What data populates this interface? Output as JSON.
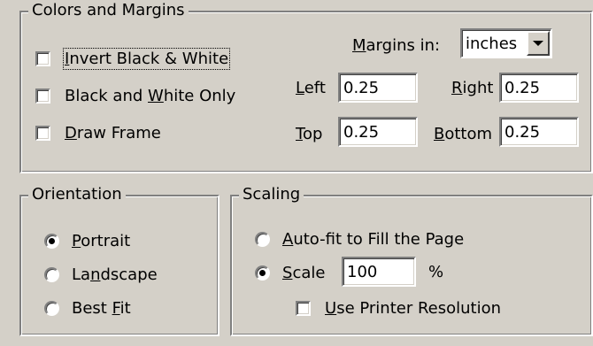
{
  "colors_margins": {
    "legend": "Colors and Margins",
    "invert_prefix": "",
    "invert_key": "I",
    "invert_rest": "nvert Black & White",
    "bw_prefix": "Black and ",
    "bw_key": "W",
    "bw_rest": "hite Only",
    "frame_prefix": "",
    "frame_key": "D",
    "frame_rest": "raw Frame",
    "invert_checked": false,
    "bw_checked": false,
    "frame_checked": false,
    "margins_in_key": "M",
    "margins_in_rest": "argins in:",
    "units_value": "inches",
    "left_key": "L",
    "left_rest": "eft",
    "left_value": "0.25",
    "right_key": "R",
    "right_rest": "ight",
    "right_value": "0.25",
    "top_key": "T",
    "top_rest": "op",
    "top_value": "0.25",
    "bottom_key": "B",
    "bottom_rest": "ottom",
    "bottom_value": "0.25"
  },
  "orientation": {
    "legend": "Orientation",
    "portrait_key": "P",
    "portrait_rest": "ortrait",
    "landscape_prefix": "La",
    "landscape_key": "n",
    "landscape_rest": "dscape",
    "bestfit_prefix": "Best ",
    "bestfit_key": "F",
    "bestfit_rest": "it",
    "selected": "Portrait"
  },
  "scaling": {
    "legend": "Scaling",
    "autofit_key": "A",
    "autofit_rest": "uto-fit to Fill the Page",
    "scale_key": "S",
    "scale_rest": "cale",
    "scale_value": "100",
    "percent": "%",
    "printer_res_key": "U",
    "printer_res_rest": "se Printer Resolution",
    "selected": "Scale",
    "printer_res_checked": false
  }
}
